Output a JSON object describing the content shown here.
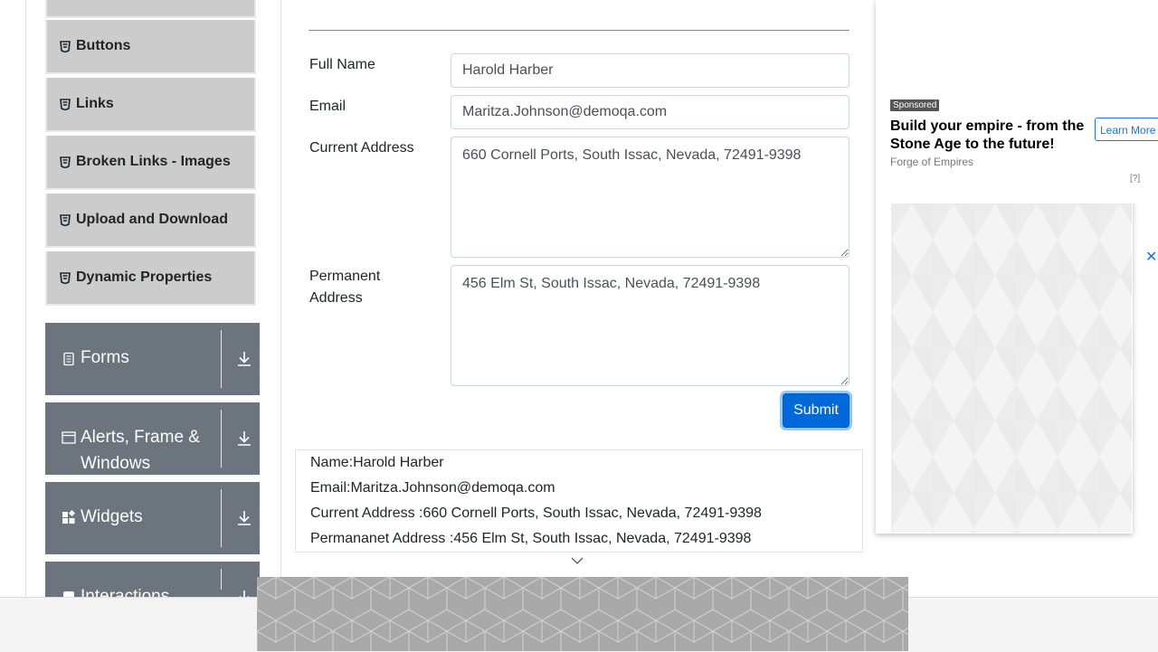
{
  "sidebar": {
    "elements_items": [
      {
        "label": "Buttons",
        "icon": "html5-icon"
      },
      {
        "label": "Links",
        "icon": "html5-icon"
      },
      {
        "label": "Broken Links - Images",
        "icon": "html5-icon"
      },
      {
        "label": "Upload and Download",
        "icon": "html5-icon"
      },
      {
        "label": "Dynamic Properties",
        "icon": "html5-icon"
      }
    ],
    "groups": [
      {
        "label": "Forms",
        "icon": "document-icon"
      },
      {
        "label": "Alerts, Frame &",
        "label2": "Windows",
        "icon": "window-icon"
      },
      {
        "label": "Widgets",
        "icon": "widgets-icon"
      },
      {
        "label": "Interactions",
        "icon": "interactions-icon"
      }
    ]
  },
  "form": {
    "full_name_label": "Full Name",
    "full_name_value": "Harold Harber",
    "email_label": "Email",
    "email_value": "Maritza.Johnson@demoqa.com",
    "current_address_label": "Current Address",
    "current_address_value": "660 Cornell Ports, South Issac, Nevada, 72491-9398",
    "permanent_address_label_1": "Permanent",
    "permanent_address_label_2": "Address",
    "permanent_address_value": "456 Elm St, South Issac, Nevada, 72491-9398",
    "submit_label": "Submit"
  },
  "output": {
    "name": "Name:Harold Harber",
    "email": "Email:Maritza.Johnson@demoqa.com",
    "current_address": "Current Address :660 Cornell Ports, South Issac, Nevada, 72491-9398",
    "permanent_address": "Permananet Address :456 Elm St, South Issac, Nevada, 72491-9398"
  },
  "ad": {
    "sponsored": "Sponsored",
    "title": "Build your empire - from the Stone Age to the future!",
    "source": "Forge of Empires",
    "cta": "Learn More",
    "help": "[?]",
    "close": "✕"
  },
  "colors": {
    "submit_bg": "#0069d9",
    "menu_item_bg": "#cccccc",
    "group_bg": "#6c757d"
  }
}
